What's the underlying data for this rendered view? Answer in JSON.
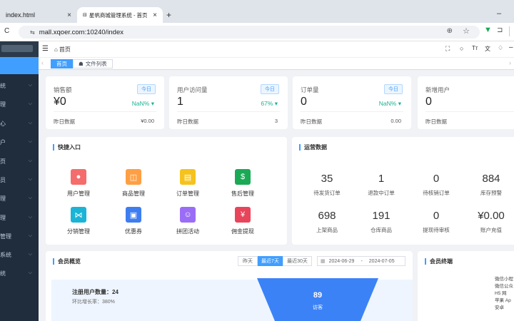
{
  "browser": {
    "tabs": [
      {
        "title": "index.html",
        "close": "×"
      },
      {
        "title": "星帆商城管理系统 - 首页",
        "close": "×"
      }
    ],
    "new_tab": "+",
    "minimize": "–",
    "reload": "C",
    "url": "mall.xqoer.com:10240/index"
  },
  "sidebar": {
    "items": [
      {
        "label": "统"
      },
      {
        "label": "理"
      },
      {
        "label": "心"
      },
      {
        "label": "户"
      },
      {
        "label": "页"
      },
      {
        "label": "员"
      },
      {
        "label": "理"
      },
      {
        "label": "理"
      },
      {
        "label": "管理"
      },
      {
        "label": "系统"
      },
      {
        "label": "统"
      }
    ]
  },
  "navbar": {
    "breadcrumb": "首页"
  },
  "tags": {
    "home": "首页",
    "other": "文件列表"
  },
  "stats": [
    {
      "title": "销售额",
      "badge": "今日",
      "value": "¥0",
      "pct": "NaN%",
      "arrow": "▾",
      "ylabel": "昨日数据",
      "yval": "¥0.00"
    },
    {
      "title": "用户访问量",
      "badge": "今日",
      "value": "1",
      "pct": "67%",
      "arrow": "▾",
      "ylabel": "昨日数据",
      "yval": "3"
    },
    {
      "title": "订单量",
      "badge": "今日",
      "value": "0",
      "pct": "NaN%",
      "arrow": "▾",
      "ylabel": "昨日数据",
      "yval": "0.00"
    },
    {
      "title": "新增用户",
      "badge": "",
      "value": "0",
      "pct": "",
      "arrow": "",
      "ylabel": "昨日数据",
      "yval": ""
    }
  ],
  "quick": {
    "title": "快捷入口",
    "items": [
      {
        "label": "用户管理",
        "icon": "user-icon",
        "glyph": "👤",
        "color": "#f56c6c"
      },
      {
        "label": "商品管理",
        "icon": "cube-icon",
        "glyph": "◫",
        "color": "#ff9f43"
      },
      {
        "label": "订单管理",
        "icon": "order-icon",
        "glyph": "▤",
        "color": "#f5c31c"
      },
      {
        "label": "售后管理",
        "icon": "aftersale-icon",
        "glyph": "$",
        "color": "#1aaa55"
      },
      {
        "label": "分销管理",
        "icon": "share-icon",
        "glyph": "⋈",
        "color": "#1bb4d6"
      },
      {
        "label": "优惠券",
        "icon": "coupon-icon",
        "glyph": "▣",
        "color": "#3d7df0"
      },
      {
        "label": "拼团活动",
        "icon": "group-icon",
        "glyph": "☺",
        "color": "#9b6df7"
      },
      {
        "label": "佣金提现",
        "icon": "withdraw-icon",
        "glyph": "¥",
        "color": "#e8455a"
      }
    ]
  },
  "ops": {
    "title": "运营数据",
    "items": [
      {
        "value": "35",
        "label": "待发货订单"
      },
      {
        "value": "1",
        "label": "退款中订单"
      },
      {
        "value": "0",
        "label": "待核销订单"
      },
      {
        "value": "884",
        "label": "库存预警"
      },
      {
        "value": "698",
        "label": "上架商品"
      },
      {
        "value": "191",
        "label": "仓库商品"
      },
      {
        "value": "0",
        "label": "提现待审核"
      },
      {
        "value": "¥0.00",
        "label": "账户充值"
      }
    ]
  },
  "overview": {
    "title": "会员概览",
    "buttons": [
      "昨天",
      "最近7天",
      "最近30天"
    ],
    "date_start": "2024-06-29",
    "date_sep": "-",
    "date_end": "2024-07-05",
    "reg_label": "注册用户数量：24",
    "growth_label": "环比增长率：380%",
    "funnel_value": "89",
    "funnel_label": "访客"
  },
  "terminal": {
    "title": "会员终端",
    "labels": [
      "微信小程",
      "微信公众",
      "H5 网",
      "苹果 Ap",
      "安卓"
    ]
  },
  "colors": {
    "accent": "#409eff",
    "sidebar": "#1f2d3d"
  }
}
